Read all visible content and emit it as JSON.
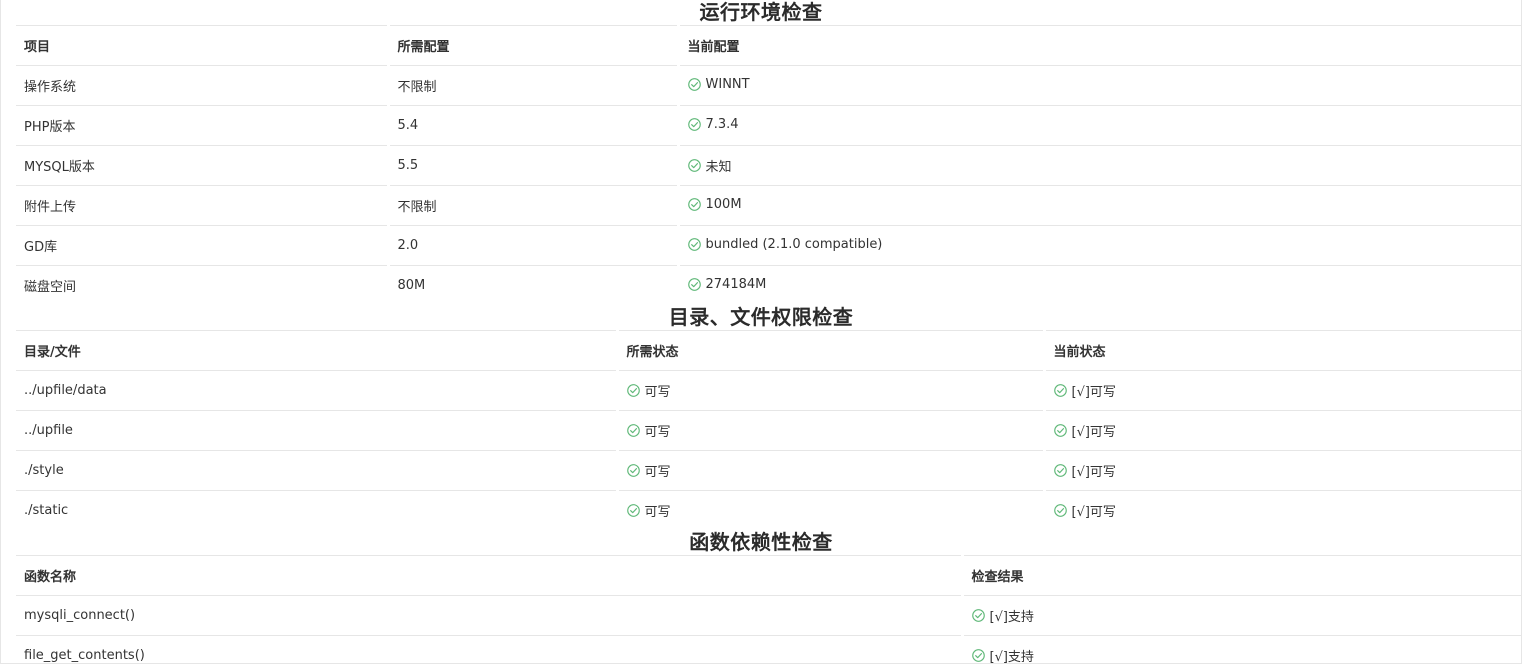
{
  "env_check": {
    "title": "运行环境检查",
    "headers": [
      "项目",
      "所需配置",
      "当前配置"
    ],
    "rows": [
      {
        "item": "操作系统",
        "required": "不限制",
        "current": "WINNT"
      },
      {
        "item": "PHP版本",
        "required": "5.4",
        "current": "7.3.4"
      },
      {
        "item": "MYSQL版本",
        "required": "5.5",
        "current": "未知"
      },
      {
        "item": "附件上传",
        "required": "不限制",
        "current": "100M"
      },
      {
        "item": "GD库",
        "required": "2.0",
        "current": "bundled (2.1.0 compatible)"
      },
      {
        "item": "磁盘空间",
        "required": "80M",
        "current": "274184M"
      }
    ]
  },
  "dir_check": {
    "title": "目录、文件权限检查",
    "headers": [
      "目录/文件",
      "所需状态",
      "当前状态"
    ],
    "rows": [
      {
        "path": "../upfile/data",
        "required": "可写",
        "current": "[√]可写"
      },
      {
        "path": "../upfile",
        "required": "可写",
        "current": "[√]可写"
      },
      {
        "path": "./style",
        "required": "可写",
        "current": "[√]可写"
      },
      {
        "path": "./static",
        "required": "可写",
        "current": "[√]可写"
      }
    ]
  },
  "func_check": {
    "title": "函数依赖性检查",
    "headers": [
      "函数名称",
      "检查结果"
    ],
    "rows": [
      {
        "name": "mysqli_connect()",
        "result": "[√]支持"
      },
      {
        "name": "file_get_contents()",
        "result": "[√]支持"
      }
    ]
  },
  "colors": {
    "check_green": "#5fb878",
    "border": "#e6e6e6",
    "text": "#333333"
  },
  "icons": {
    "status": "circle-check-icon"
  }
}
